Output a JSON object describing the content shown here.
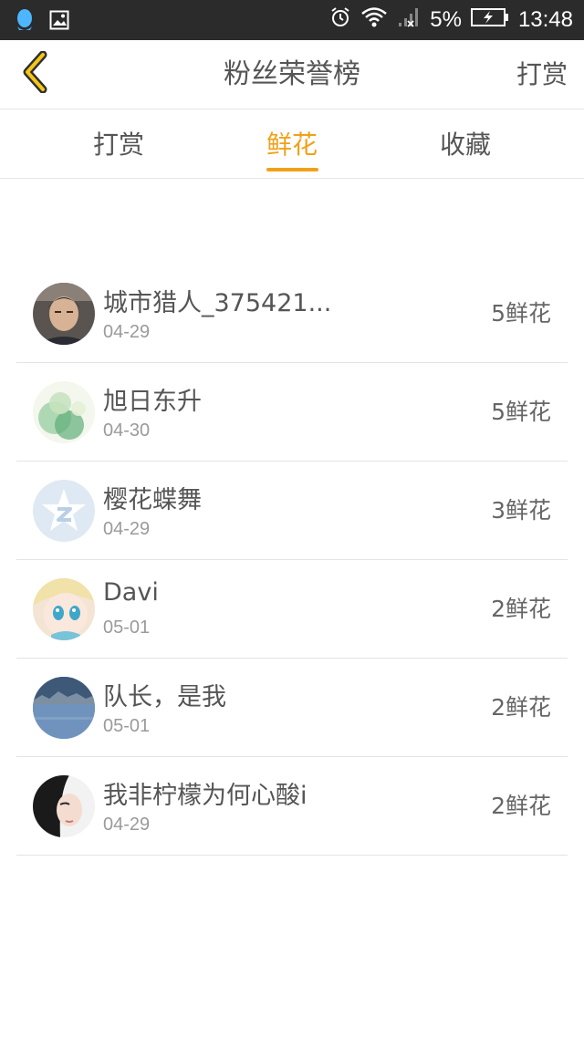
{
  "status_bar": {
    "battery": "5%",
    "time": "13:48",
    "icons": [
      "qq-icon",
      "image-icon",
      "alarm-icon",
      "wifi-icon",
      "signal-icon",
      "battery-icon"
    ]
  },
  "header": {
    "title": "粉丝荣誉榜",
    "right_action": "打赏",
    "back_icon": "chevron-left-icon"
  },
  "tabs": [
    {
      "label": "打赏",
      "active": false
    },
    {
      "label": "鲜花",
      "active": true
    },
    {
      "label": "收藏",
      "active": false
    }
  ],
  "colors": {
    "accent": "#f0a11a",
    "text": "#555555",
    "subtext": "#9a9a9a",
    "divider": "#e3e3e3",
    "status_bar": "#2b2b2b"
  },
  "rows": [
    {
      "name": "城市猎人_375421...",
      "date": "04-29",
      "count": "5鲜花",
      "avatar": "photo-avatar"
    },
    {
      "name": "旭日东升",
      "date": "04-30",
      "count": "5鲜花",
      "avatar": "green-watercolor-avatar"
    },
    {
      "name": "樱花蝶舞",
      "date": "04-29",
      "count": "3鲜花",
      "avatar": "default-star-avatar"
    },
    {
      "name": "Davi",
      "date": "05-01",
      "count": "2鲜花",
      "avatar": "anime-avatar"
    },
    {
      "name": "队长，是我",
      "date": "05-01",
      "count": "2鲜花",
      "avatar": "landscape-avatar"
    },
    {
      "name": "我非柠檬为何心酸i",
      "date": "04-29",
      "count": "2鲜花",
      "avatar": "portrait-avatar"
    }
  ]
}
